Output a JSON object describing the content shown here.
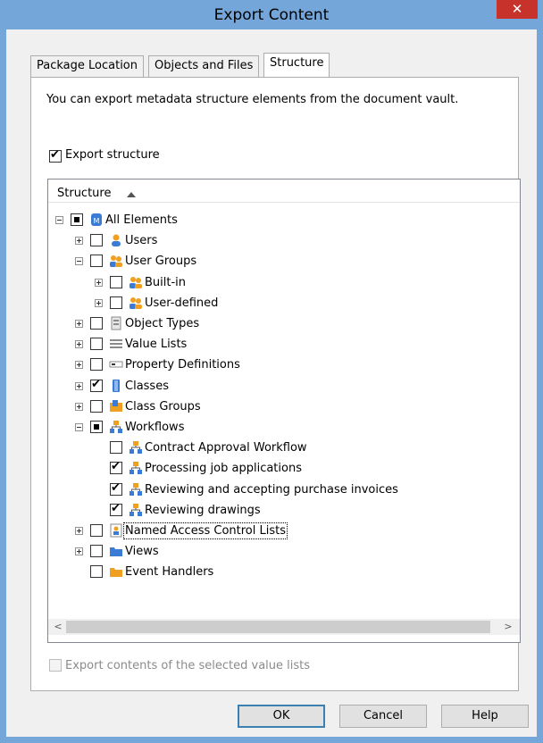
{
  "window": {
    "title": "Export Content",
    "close_glyph": "✕"
  },
  "tabs": [
    {
      "label": "Package Location"
    },
    {
      "label": "Objects and Files"
    },
    {
      "label": "Structure"
    }
  ],
  "intro_text": "You can export metadata structure elements from the document vault.",
  "export_structure": {
    "label": "Export structure",
    "checked": true
  },
  "tree": {
    "header": "Structure",
    "items": [
      {
        "label": "All Elements",
        "state": "partial",
        "expander": "minus",
        "icon": "metadata-vault-icon"
      },
      {
        "label": "Users",
        "state": "unchecked",
        "expander": "plus",
        "icon": "user-icon"
      },
      {
        "label": "User Groups",
        "state": "unchecked",
        "expander": "minus",
        "icon": "user-group-icon"
      },
      {
        "label": "Built-in",
        "state": "unchecked",
        "expander": "plus",
        "icon": "user-group-icon"
      },
      {
        "label": "User-defined",
        "state": "unchecked",
        "expander": "plus",
        "icon": "user-group-icon"
      },
      {
        "label": "Object Types",
        "state": "unchecked",
        "expander": "plus",
        "icon": "object-type-icon"
      },
      {
        "label": "Value Lists",
        "state": "unchecked",
        "expander": "plus",
        "icon": "value-list-icon"
      },
      {
        "label": "Property Definitions",
        "state": "unchecked",
        "expander": "plus",
        "icon": "property-definition-icon"
      },
      {
        "label": "Classes",
        "state": "checked",
        "expander": "plus",
        "icon": "class-icon"
      },
      {
        "label": "Class Groups",
        "state": "unchecked",
        "expander": "plus",
        "icon": "class-group-icon"
      },
      {
        "label": "Workflows",
        "state": "partial",
        "expander": "minus",
        "icon": "workflow-icon"
      },
      {
        "label": "Contract Approval Workflow",
        "state": "unchecked",
        "expander": "none",
        "icon": "workflow-icon"
      },
      {
        "label": "Processing job applications",
        "state": "checked",
        "expander": "none",
        "icon": "workflow-icon"
      },
      {
        "label": "Reviewing and accepting purchase invoices",
        "state": "checked",
        "expander": "none",
        "icon": "workflow-icon"
      },
      {
        "label": "Reviewing drawings",
        "state": "checked",
        "expander": "none",
        "icon": "workflow-icon"
      },
      {
        "label": "Named Access Control Lists",
        "state": "unchecked",
        "expander": "plus",
        "icon": "access-control-list-icon"
      },
      {
        "label": "Views",
        "state": "unchecked",
        "expander": "plus",
        "icon": "view-folder-icon"
      },
      {
        "label": "Event Handlers",
        "state": "unchecked",
        "expander": "none",
        "icon": "event-handler-folder-icon"
      }
    ]
  },
  "scroll_left_glyph": "<",
  "scroll_right_glyph": ">",
  "export_value_lists": {
    "label": "Export contents of the selected value lists",
    "checked": false,
    "enabled": false
  },
  "buttons": {
    "ok": "OK",
    "cancel": "Cancel",
    "help": "Help"
  },
  "colors": {
    "titlebar": "#74a6d9",
    "close": "#c7322a",
    "selection": "#3399ff"
  }
}
